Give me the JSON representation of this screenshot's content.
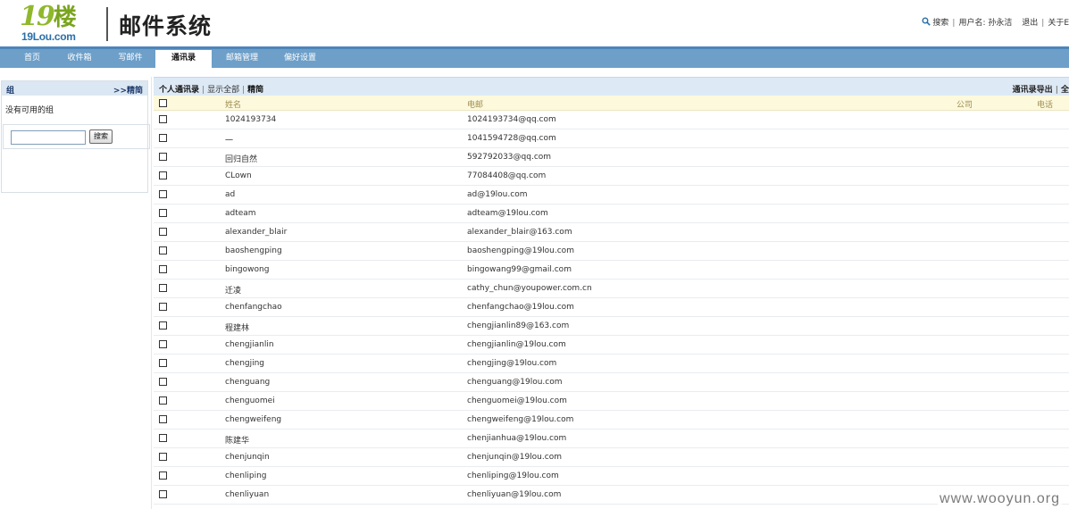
{
  "header": {
    "logo_big": "19",
    "logo_big_lou": "楼",
    "logo_small": "19Lou.com",
    "app_title": "邮件系统",
    "search_label": "搜索",
    "username_label": "用户名: 孙永洁",
    "logout_label": "退出",
    "about_label": "关于E"
  },
  "nav": {
    "items": [
      "首页",
      "收件箱",
      "写邮件",
      "通讯录",
      "邮箱管理",
      "偏好设置"
    ],
    "active_index": 3
  },
  "sidebar": {
    "group_title": "组",
    "collapse_label": ">>精简",
    "empty_text": "没有可用的组",
    "search_button": "搜索",
    "search_value": ""
  },
  "toolbar": {
    "personal_contacts": "个人通讯录",
    "show_all": "显示全部",
    "simplify": "精简",
    "export": "通讯录导出",
    "cut_off": "全"
  },
  "table": {
    "columns": [
      "姓名",
      "电邮",
      "公司",
      "电话"
    ],
    "rows": [
      {
        "name": "1024193734",
        "email": "1024193734@qq.com"
      },
      {
        "name": "一",
        "email": "1041594728@qq.com"
      },
      {
        "name": "回归自然",
        "email": "592792033@qq.com"
      },
      {
        "name": "CLown",
        "email": "77084408@qq.com"
      },
      {
        "name": "ad",
        "email": "ad@19lou.com"
      },
      {
        "name": "adteam",
        "email": "adteam@19lou.com"
      },
      {
        "name": "alexander_blair",
        "email": "alexander_blair@163.com"
      },
      {
        "name": "baoshengping",
        "email": "baoshengping@19lou.com"
      },
      {
        "name": "bingowong",
        "email": "bingowang99@gmail.com"
      },
      {
        "name": "迁凌",
        "email": "cathy_chun@youpower.com.cn"
      },
      {
        "name": "chenfangchao",
        "email": "chenfangchao@19lou.com"
      },
      {
        "name": "程建林",
        "email": "chengjianlin89@163.com"
      },
      {
        "name": "chengjianlin",
        "email": "chengjianlin@19lou.com"
      },
      {
        "name": "chengjing",
        "email": "chengjing@19lou.com"
      },
      {
        "name": "chenguang",
        "email": "chenguang@19lou.com"
      },
      {
        "name": "chenguomei",
        "email": "chenguomei@19lou.com"
      },
      {
        "name": "chengweifeng",
        "email": "chengweifeng@19lou.com"
      },
      {
        "name": "陈建华",
        "email": "chenjianhua@19lou.com"
      },
      {
        "name": "chenjunqin",
        "email": "chenjunqin@19lou.com"
      },
      {
        "name": "chenliping",
        "email": "chenliping@19lou.com"
      },
      {
        "name": "chenliyuan",
        "email": "chenliyuan@19lou.com"
      }
    ]
  },
  "watermark": "www.wooyun.org",
  "colors": {
    "nav_bg": "#6d9fc9",
    "toolbar_bg": "#dde9f4",
    "thead_bg": "#fdf9dc",
    "logo_green": "#8fb82c",
    "logo_blue": "#2a6fa8"
  }
}
